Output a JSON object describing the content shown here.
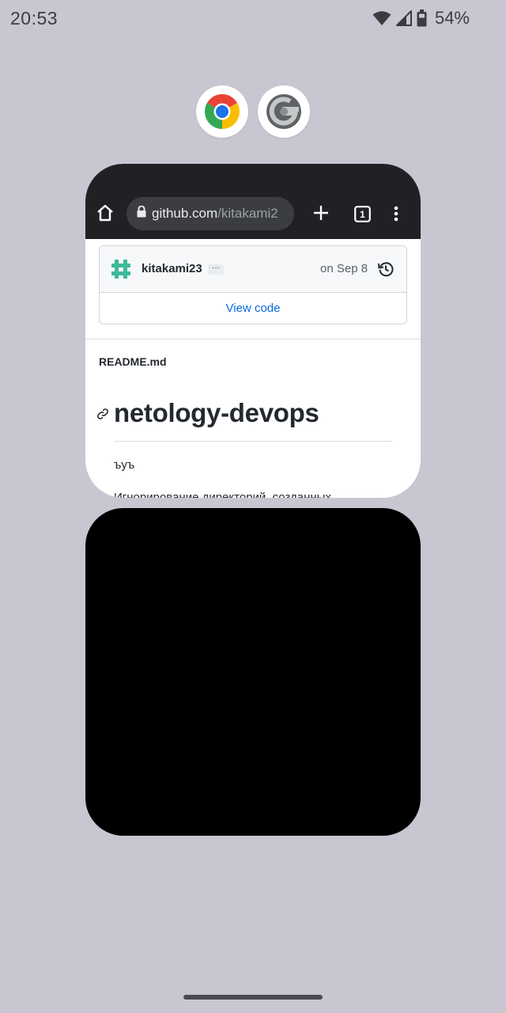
{
  "status_bar": {
    "time": "20:53",
    "battery_percent": "54%",
    "icons": [
      "wifi-icon",
      "cell-signal-icon",
      "battery-icon"
    ]
  },
  "app_icons": [
    {
      "name": "chrome-icon"
    },
    {
      "name": "google-one-icon"
    }
  ],
  "browser_card": {
    "toolbar": {
      "url_domain": "github.com",
      "url_path": "/kitakami2",
      "tab_count": "1"
    },
    "commit": {
      "author": "kitakami23",
      "ellipsis": "···",
      "date": "on Sep 8",
      "view_code": "View code"
    },
    "readme": {
      "filename": "README.md",
      "title": "netology-devops",
      "line1": "ъуъ",
      "line2": "Игнорирование директорий, созданных"
    }
  },
  "colors": {
    "background": "#c9c6d1",
    "toolbar": "#202124",
    "link": "#0969da",
    "avatar": "#3fb99a"
  }
}
